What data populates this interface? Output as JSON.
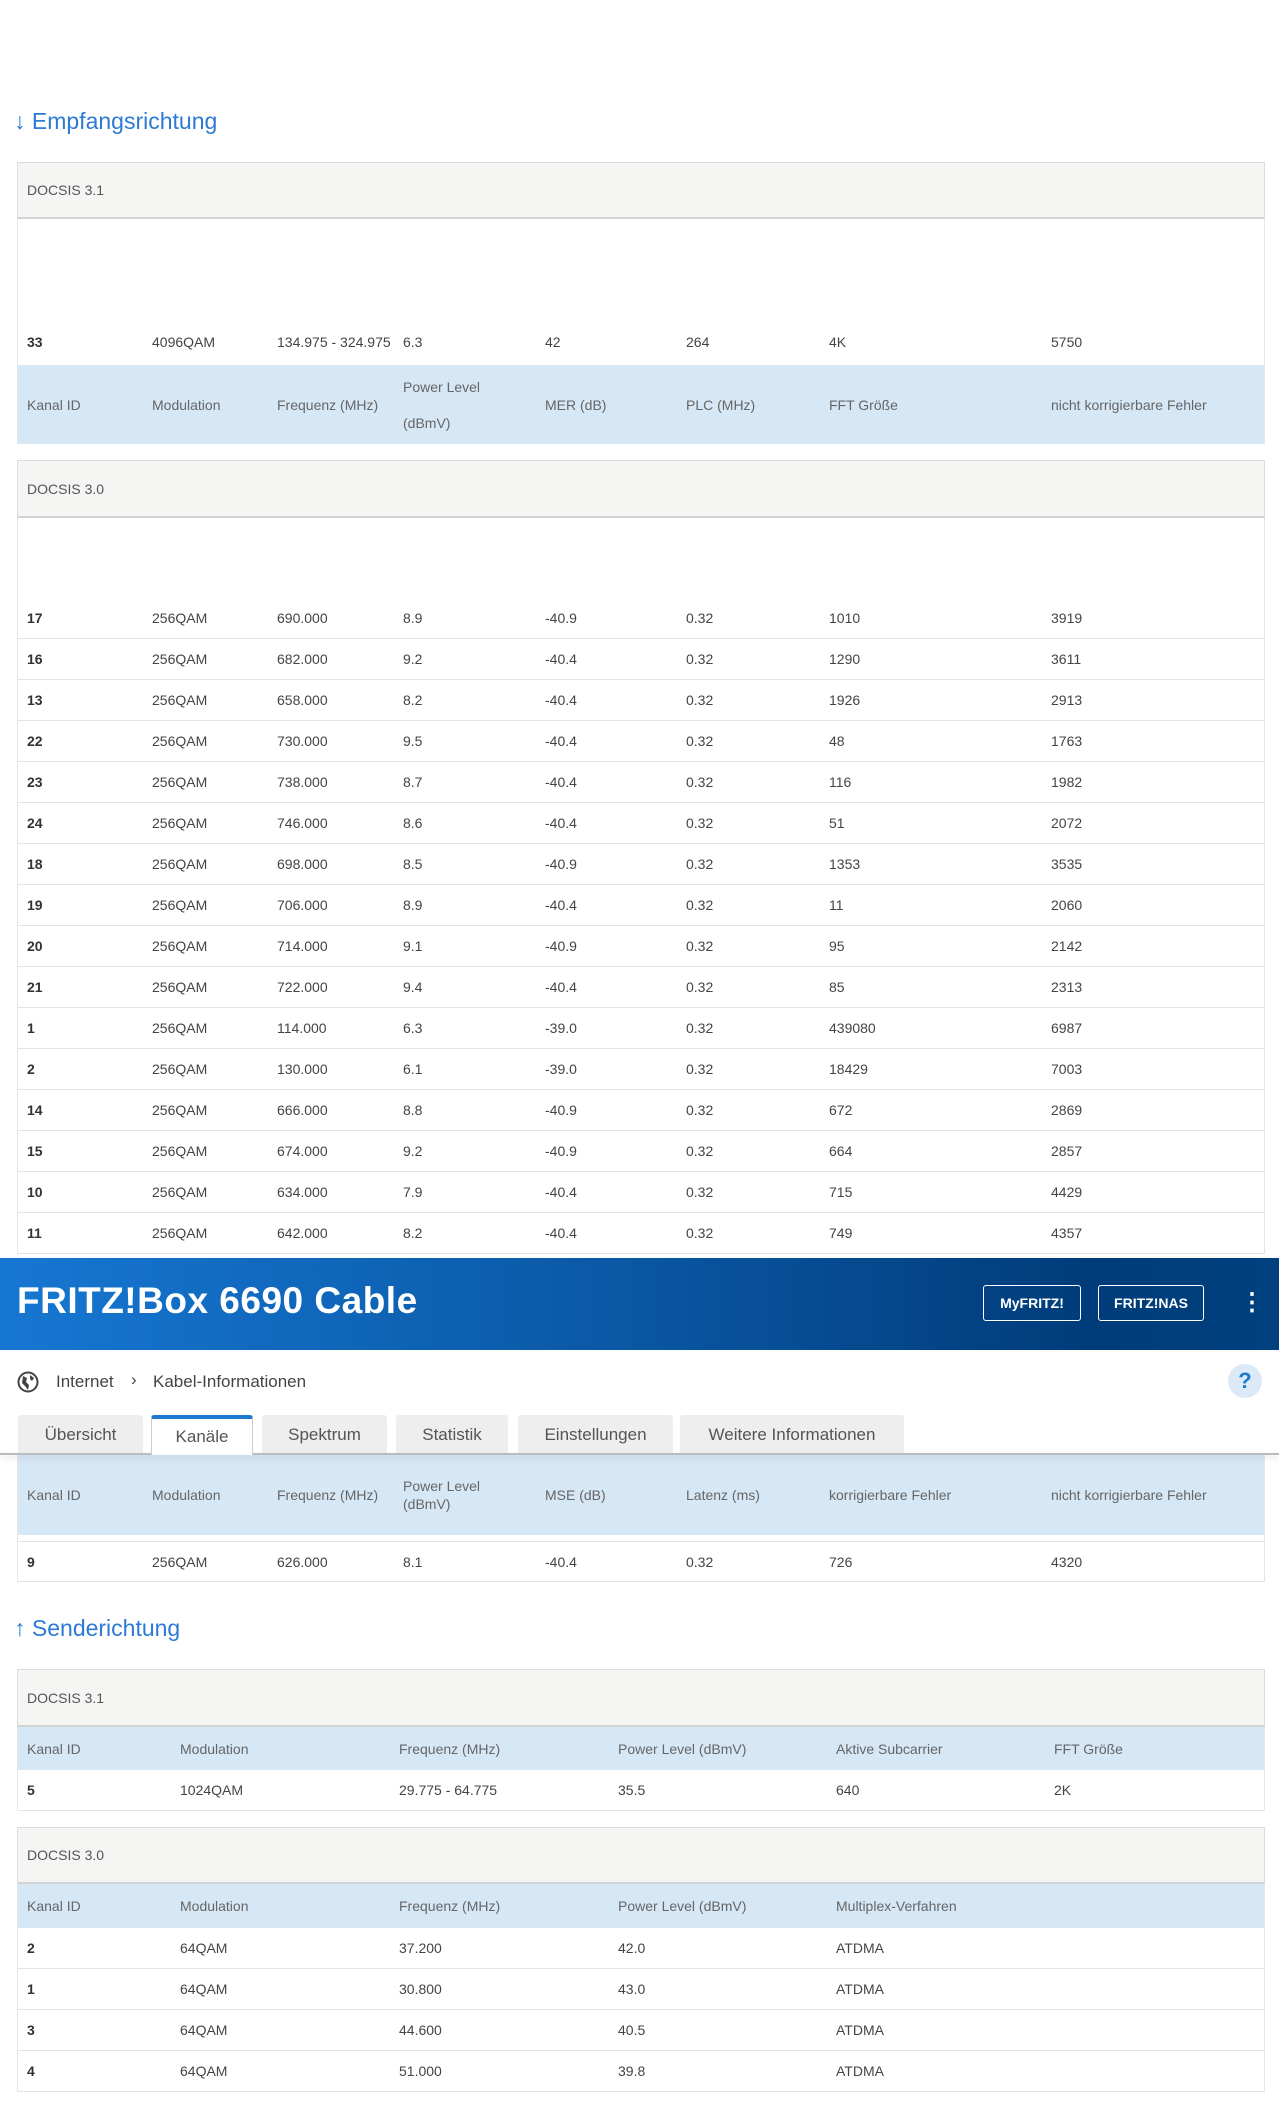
{
  "downstream": {
    "heading": "↓ Empfangsrichtung",
    "docsis31": {
      "label": "DOCSIS 3.1",
      "headers": [
        "Kanal ID",
        "Modulation",
        "Frequenz (MHz)",
        "Power Level (dBmV)",
        "MER (dB)",
        "PLC (MHz)",
        "FFT Größe",
        "nicht korrigierbare Fehler"
      ],
      "rows": [
        [
          "33",
          "4096QAM",
          "134.975 - 324.975",
          "6.3",
          "42",
          "264",
          "4K",
          "5750"
        ]
      ]
    },
    "docsis30": {
      "label": "DOCSIS 3.0",
      "headers": [
        "Kanal ID",
        "Modulation",
        "Frequenz (MHz)",
        "Power Level (dBmV)",
        "MSE (dB)",
        "Latenz (ms)",
        "korrigierbare Fehler",
        "nicht korrigierbare Fehler"
      ],
      "rows": [
        [
          "17",
          "256QAM",
          "690.000",
          "8.9",
          "-40.9",
          "0.32",
          "1010",
          "3919"
        ],
        [
          "16",
          "256QAM",
          "682.000",
          "9.2",
          "-40.4",
          "0.32",
          "1290",
          "3611"
        ],
        [
          "13",
          "256QAM",
          "658.000",
          "8.2",
          "-40.4",
          "0.32",
          "1926",
          "2913"
        ],
        [
          "22",
          "256QAM",
          "730.000",
          "9.5",
          "-40.4",
          "0.32",
          "48",
          "1763"
        ],
        [
          "23",
          "256QAM",
          "738.000",
          "8.7",
          "-40.4",
          "0.32",
          "116",
          "1982"
        ],
        [
          "24",
          "256QAM",
          "746.000",
          "8.6",
          "-40.4",
          "0.32",
          "51",
          "2072"
        ],
        [
          "18",
          "256QAM",
          "698.000",
          "8.5",
          "-40.9",
          "0.32",
          "1353",
          "3535"
        ],
        [
          "19",
          "256QAM",
          "706.000",
          "8.9",
          "-40.4",
          "0.32",
          "11",
          "2060"
        ],
        [
          "20",
          "256QAM",
          "714.000",
          "9.1",
          "-40.9",
          "0.32",
          "95",
          "2142"
        ],
        [
          "21",
          "256QAM",
          "722.000",
          "9.4",
          "-40.4",
          "0.32",
          "85",
          "2313"
        ],
        [
          "1",
          "256QAM",
          "114.000",
          "6.3",
          "-39.0",
          "0.32",
          "439080",
          "6987"
        ],
        [
          "2",
          "256QAM",
          "130.000",
          "6.1",
          "-39.0",
          "0.32",
          "18429",
          "7003"
        ],
        [
          "14",
          "256QAM",
          "666.000",
          "8.8",
          "-40.9",
          "0.32",
          "672",
          "2869"
        ],
        [
          "15",
          "256QAM",
          "674.000",
          "9.2",
          "-40.9",
          "0.32",
          "664",
          "2857"
        ],
        [
          "10",
          "256QAM",
          "634.000",
          "7.9",
          "-40.4",
          "0.32",
          "715",
          "4429"
        ],
        [
          "11",
          "256QAM",
          "642.000",
          "8.2",
          "-40.4",
          "0.32",
          "749",
          "4357"
        ]
      ],
      "last_row": [
        "9",
        "256QAM",
        "626.000",
        "8.1",
        "-40.4",
        "0.32",
        "726",
        "4320"
      ]
    }
  },
  "header": {
    "title": "FRITZ!Box 6690 Cable",
    "buttons": [
      "MyFRITZ!",
      "FRITZ!NAS"
    ],
    "menu_icon": "⋮",
    "breadcrumb": [
      "Internet",
      "Kabel-Informationen"
    ],
    "help": "?",
    "tabs": [
      "Übersicht",
      "Kanäle",
      "Spektrum",
      "Statistik",
      "Einstellungen",
      "Weitere Informationen"
    ],
    "active_tab": "Kanäle"
  },
  "upstream": {
    "heading": "↑ Senderichtung",
    "docsis31": {
      "label": "DOCSIS 3.1",
      "headers": [
        "Kanal ID",
        "Modulation",
        "Frequenz (MHz)",
        "Power Level (dBmV)",
        "Aktive Subcarrier",
        "FFT Größe"
      ],
      "rows": [
        [
          "5",
          "1024QAM",
          "29.775 - 64.775",
          "35.5",
          "640",
          "2K"
        ]
      ]
    },
    "docsis30": {
      "label": "DOCSIS 3.0",
      "headers": [
        "Kanal ID",
        "Modulation",
        "Frequenz (MHz)",
        "Power Level (dBmV)",
        "Multiplex-Verfahren"
      ],
      "rows": [
        [
          "2",
          "64QAM",
          "37.200",
          "42.0",
          "ATDMA"
        ],
        [
          "1",
          "64QAM",
          "30.800",
          "43.0",
          "ATDMA"
        ],
        [
          "3",
          "64QAM",
          "44.600",
          "40.5",
          "ATDMA"
        ],
        [
          "4",
          "64QAM",
          "51.000",
          "39.8",
          "ATDMA"
        ]
      ]
    }
  }
}
